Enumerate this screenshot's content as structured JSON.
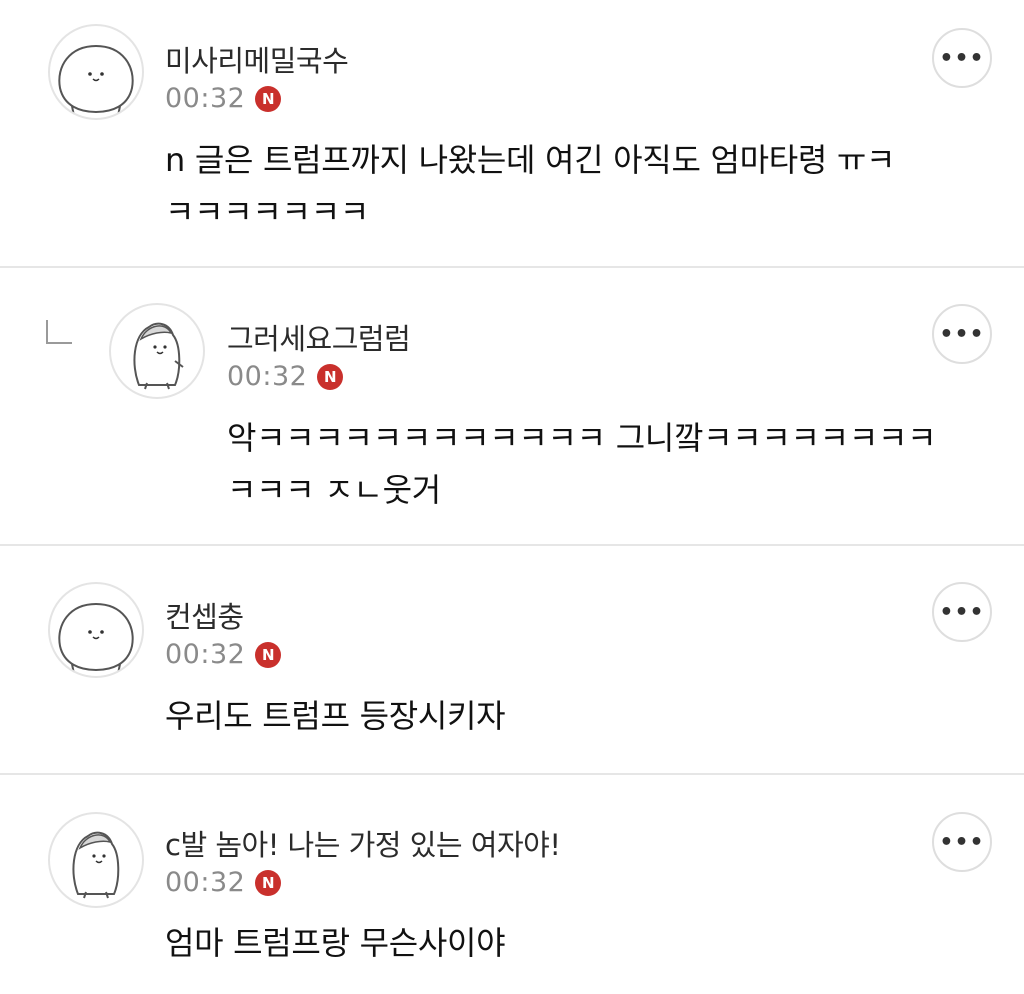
{
  "comments": [
    {
      "author": "미사리메밀국수",
      "time": "00:32",
      "badge": "N",
      "text_lines": [
        "n 글은 트럼프까지 나왔는데 여긴 아직도 엄마타령 ㅠㅋ",
        "ㅋㅋㅋㅋㅋㅋㅋ"
      ],
      "avatar_icon": "round-bear-avatar-icon",
      "is_reply": false,
      "more_label": "•••"
    },
    {
      "author": "그러세요그럼럼",
      "time": "00:32",
      "badge": "N",
      "text_lines": [
        "악ㅋㅋㅋㅋㅋㅋㅋㅋㅋㅋㅋㅋ 그니깤ㅋㅋㅋㅋㅋㅋㅋㅋ",
        "ㅋㅋㅋ ㅈㄴ웃거"
      ],
      "avatar_icon": "penguin-bear-avatar-icon",
      "is_reply": true,
      "more_label": "•••"
    },
    {
      "author": "컨셉충",
      "time": "00:32",
      "badge": "N",
      "text_lines": [
        "우리도 트럼프 등장시키자"
      ],
      "avatar_icon": "round-bear-avatar-icon",
      "is_reply": false,
      "more_label": "•••"
    },
    {
      "author": "c발 놈아! 나는 가정 있는 여자야!",
      "time": "00:32",
      "badge": "N",
      "text_lines": [
        "엄마 트럼프랑 무슨사이야"
      ],
      "avatar_icon": "penguin-bear-avatar-icon",
      "is_reply": false,
      "more_label": "•••"
    }
  ]
}
